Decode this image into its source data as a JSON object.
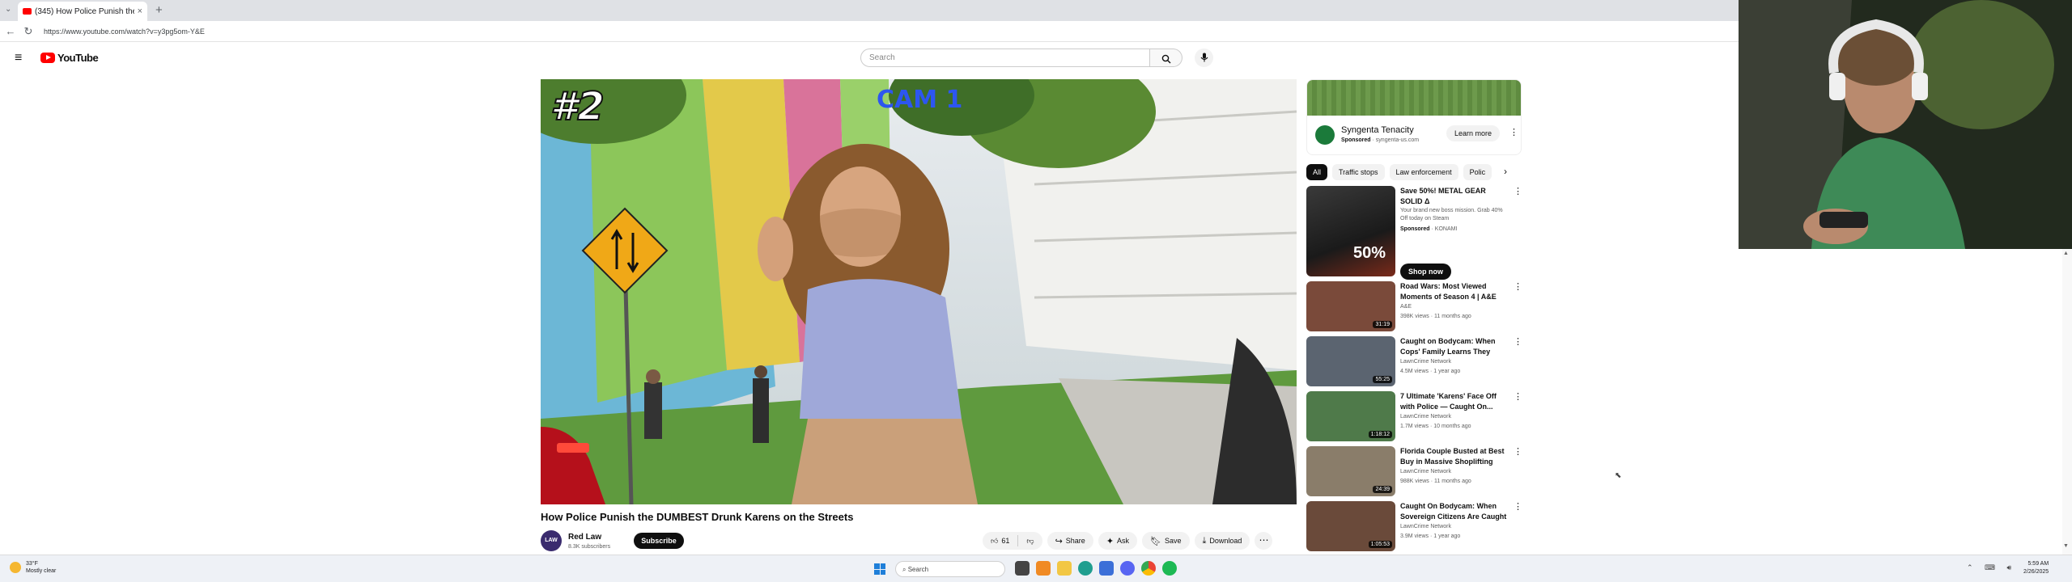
{
  "browser": {
    "tab_title": "(345) How Police Punish the D",
    "tab_close": "×",
    "new_tab": "+",
    "url": "https://www.youtube.com/watch?v=y3pg5om-Y&E"
  },
  "header": {
    "logo_text": "YouTube",
    "search_placeholder": "Search"
  },
  "video": {
    "overlay_number": "#2",
    "overlay_cam": "CAM 1",
    "title": "How Police Punish the DUMBEST Drunk Karens on the Streets",
    "channel": {
      "avatar_text": "LAW",
      "name": "Red Law",
      "subscribers": "8.3K subscribers",
      "subscribe_label": "Subscribe"
    },
    "actions": {
      "likes": "61",
      "share": "Share",
      "ask": "Ask",
      "save": "Save",
      "download": "Download"
    }
  },
  "ad": {
    "name": "Syngenta Tenacity",
    "sponsored": "Sponsored",
    "domain": "syngenta-us.com",
    "button": "Learn more"
  },
  "chips": [
    "All",
    "Traffic stops",
    "Law enforcement",
    "Polic"
  ],
  "ad2": {
    "title": "Save 50%! METAL GEAR SOLID Δ",
    "subtitle": "Your brand new boss mission. Grab 40% Off today on Steam",
    "sponsored": "Sponsored",
    "advertiser": "KONAMI",
    "thumb_text": "50%",
    "button": "Shop now"
  },
  "recommendations": [
    {
      "title": "Road Wars: Most Viewed Moments of Season 4 | A&E",
      "channel": "A&E",
      "meta": "398K views · 11 months ago",
      "duration": "31:19",
      "color": "#7a4a3a"
    },
    {
      "title": "Caught on Bodycam: When Cops' Family Learns They Aren...",
      "channel": "LawnCrime Network",
      "meta": "4.5M views · 1 year ago",
      "duration": "55:25",
      "color": "#5b6470"
    },
    {
      "title": "7 Ultimate 'Karens' Face Off with Police — Caught On...",
      "channel": "LawnCrime Network",
      "meta": "1.7M views · 10 months ago",
      "duration": "1:18:12",
      "color": "#4f7a4a"
    },
    {
      "title": "Florida Couple Busted at Best Buy in Massive Shoplifting Ring",
      "channel": "LawnCrime Network",
      "meta": "988K views · 11 months ago",
      "duration": "24:39",
      "color": "#8a7d6a"
    },
    {
      "title": "Caught On Bodycam: When Sovereign Citizens Are Caught ...",
      "channel": "LawnCrime Network",
      "meta": "3.9M views · 1 year ago",
      "duration": "1:05:53",
      "color": "#6a4a3a"
    }
  ],
  "taskbar": {
    "temp": "33°F",
    "weather": "Mostly clear",
    "search": "Search",
    "time": "5:59 AM",
    "date": "2/26/2025"
  }
}
